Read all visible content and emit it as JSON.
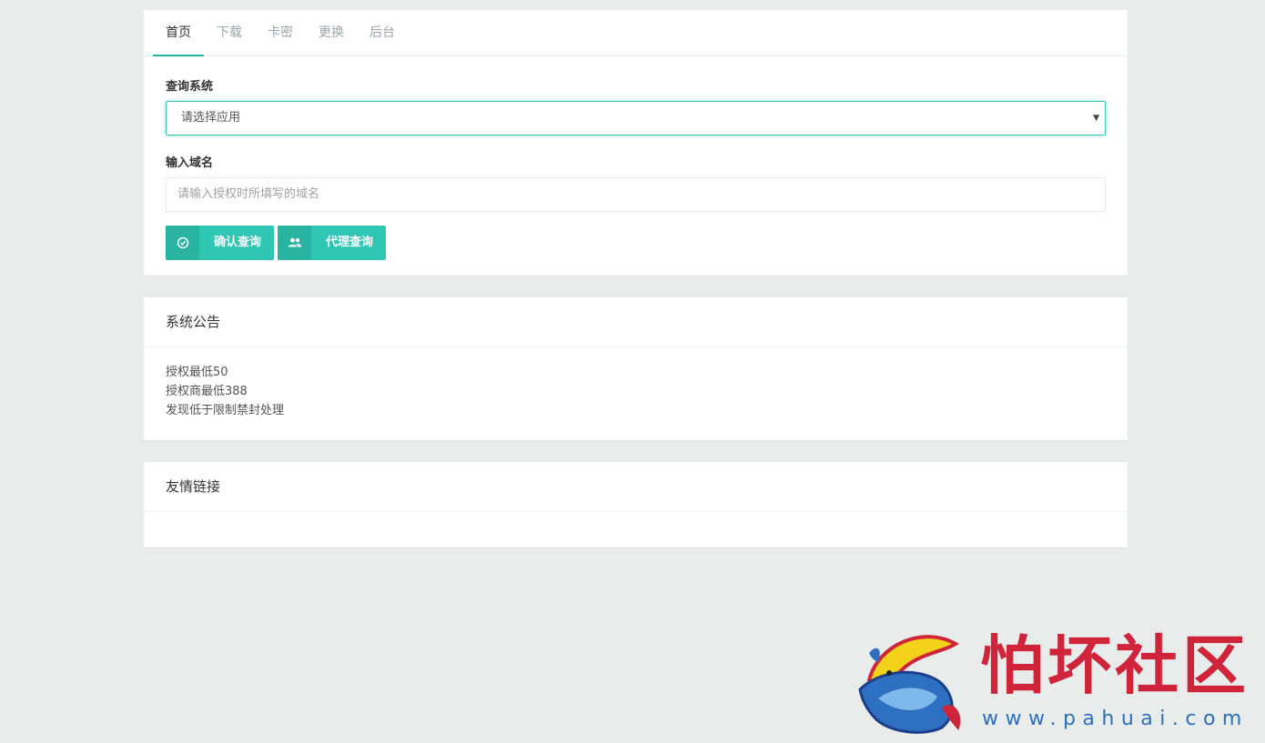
{
  "tabs": [
    {
      "label": "首页",
      "active": true
    },
    {
      "label": "下载",
      "active": false
    },
    {
      "label": "卡密",
      "active": false
    },
    {
      "label": "更换",
      "active": false
    },
    {
      "label": "后台",
      "active": false
    }
  ],
  "query_form": {
    "system_label": "查询系统",
    "system_select_value": "请选择应用",
    "domain_label": "输入域名",
    "domain_placeholder": "请输入授权时所填写的域名",
    "confirm_button": "确认查询",
    "agent_button": "代理查询"
  },
  "notice": {
    "title": "系统公告",
    "lines": [
      "授权最低50",
      "授权商最低388",
      "发现低于限制禁封处理"
    ]
  },
  "links": {
    "title": "友情链接"
  },
  "watermark": {
    "brand": "怕坏社区",
    "url": "www.pahuai.com"
  },
  "colors": {
    "accent": "#23b7a3",
    "button": "#2fc7b3",
    "background": "#e8eceb",
    "watermark_red": "#d0243a",
    "watermark_blue": "#2d6fc0"
  }
}
